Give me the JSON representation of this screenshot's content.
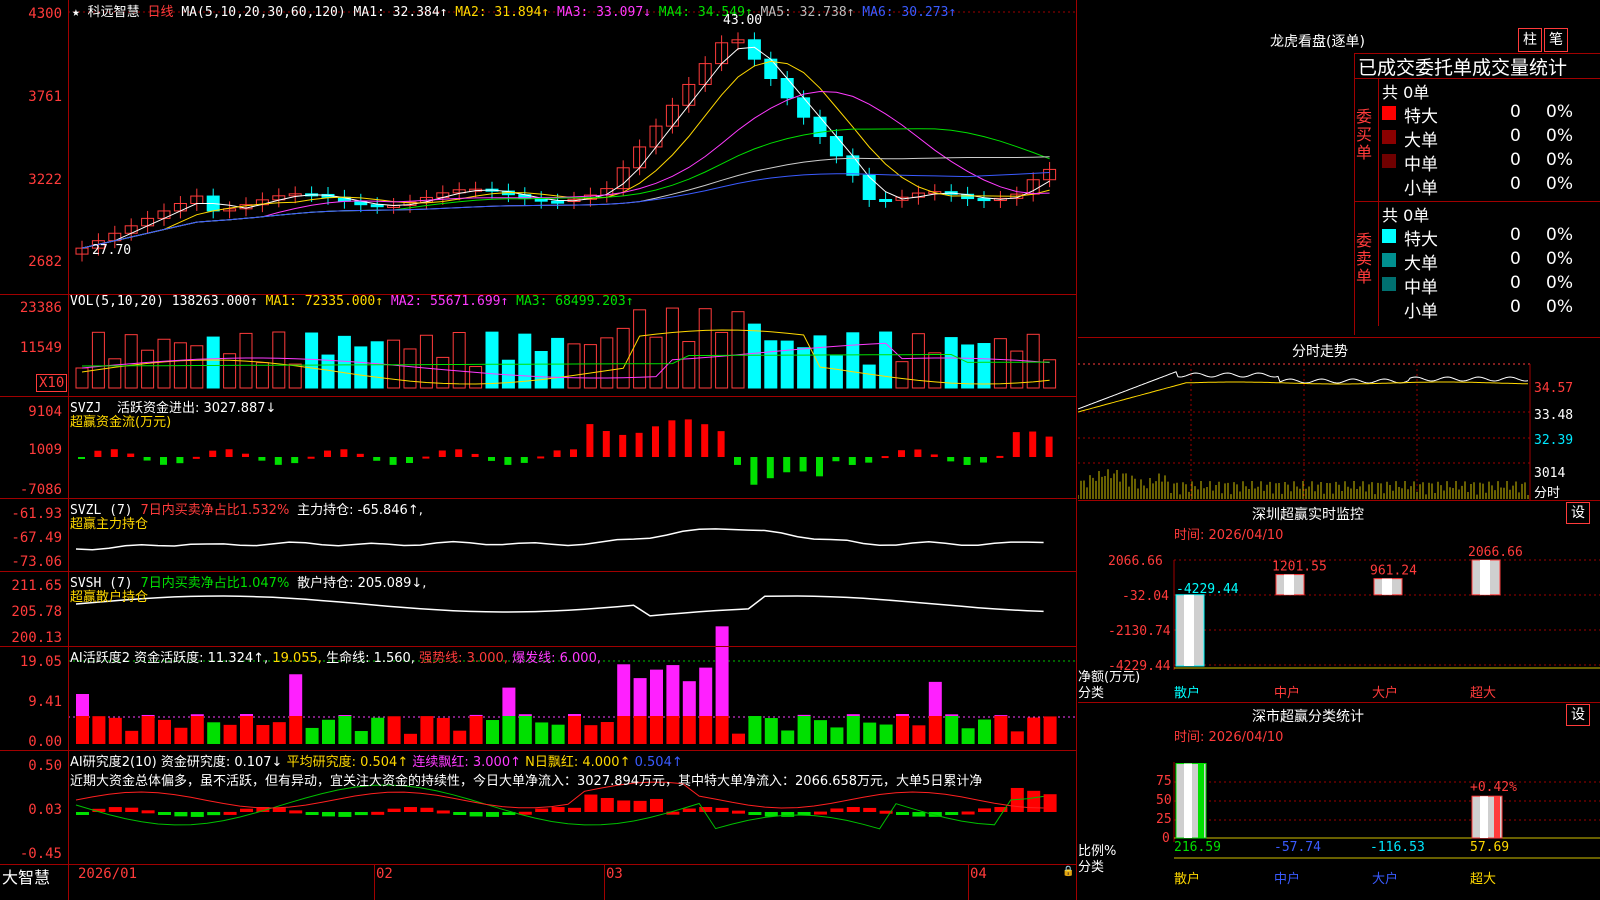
{
  "stock": {
    "star": "★",
    "name": "科远智慧",
    "period": "日线"
  },
  "ma_line": {
    "label": "MA(5,10,20,30,60,120)",
    "ma1": "MA1: 32.384↑",
    "ma2": "MA2: 31.894↑",
    "ma3": "MA3: 33.097↓",
    "ma4": "MA4: 34.549↑",
    "ma5": "MA5: 32.738↑",
    "ma6": "MA6: 30.273↑"
  },
  "price_axis": [
    "4300",
    "3761",
    "3222",
    "2682"
  ],
  "price_marks": {
    "high": "43.00",
    "low": "27.70"
  },
  "vol": {
    "label": "VOL(5,10,20)",
    "value": "138263.000↑",
    "ma1": "MA1: 72335.000↑",
    "ma2": "MA2: 55671.699↑",
    "ma3": "MA3: 68499.203↑",
    "axis": [
      "23386",
      "11549"
    ],
    "unit": "X10"
  },
  "svzj": {
    "label": "SVZJ",
    "desc": "活跃资金进出: 3027.887↓",
    "sub": "超赢资金流(万元)",
    "axis": [
      "9104",
      "1009",
      "-7086"
    ]
  },
  "svzl": {
    "label": "SVZL (7)",
    "pct": "7日内买卖净占比1.532%",
    "hold": "主力持仓: -65.846↑,",
    "sub": "超赢主力持仓",
    "axis": [
      "-61.93",
      "-67.49",
      "-73.06"
    ]
  },
  "svsh": {
    "label": "SVSH (7)",
    "pct": "7日内买卖净占比1.047%",
    "hold": "散户持仓: 205.089↓,",
    "sub": "超赢散户持仓",
    "axis": [
      "211.65",
      "205.78",
      "200.13"
    ]
  },
  "ai_active": {
    "label": "AI活跃度2",
    "act": "资金活跃度: 11.324↑,",
    "v2": "19.055,",
    "life": "生命线: 1.560,",
    "strong": "强势线: 3.000,",
    "burst": "爆发线: 6.000,",
    "axis": [
      "19.05",
      "9.41",
      "0.00"
    ]
  },
  "ai_research": {
    "label": "AI研究度2(10)",
    "res": "资金研究度: 0.107↓",
    "avg": "平均研究度: 0.504↑",
    "cont": "连续飘红: 3.000↑",
    "nday": "N日飘红: 4.000↑",
    "v5": "0.504↑",
    "text": "近期大资金总体偏多，虽不活跃，但有异动，宜关注大资金的持续性，今日大单净流入：3027.894万元，其中特大单净流入：2066.658万元，大单5日累计净",
    "axis": [
      "0.50",
      "0.03",
      "-0.45"
    ]
  },
  "dates": [
    "2026/01",
    "02",
    "03",
    "04"
  ],
  "brand": "大智慧",
  "panel_lhb": {
    "title": "龙虎看盘(逐单)",
    "btn1": "柱",
    "btn2": "笔",
    "header": "已成交委托单成交量统计",
    "buy_label": "委买单",
    "sell_label": "委卖单",
    "buy_total": "共 0单",
    "sell_total": "共 0单",
    "buy": [
      {
        "name": "特大",
        "val": "0",
        "pct": "0%",
        "color": "#ff0000"
      },
      {
        "name": "大单",
        "val": "0",
        "pct": "0%",
        "color": "#8b0000"
      },
      {
        "name": "中单",
        "val": "0",
        "pct": "0%",
        "color": "#700000"
      },
      {
        "name": "小单",
        "val": "0",
        "pct": "0%",
        "color": "#000000"
      }
    ],
    "sell": [
      {
        "name": "特大",
        "val": "0",
        "pct": "0%",
        "color": "#00ffff"
      },
      {
        "name": "大单",
        "val": "0",
        "pct": "0%",
        "color": "#009090"
      },
      {
        "name": "中单",
        "val": "0",
        "pct": "0%",
        "color": "#007070"
      },
      {
        "name": "小单",
        "val": "0",
        "pct": "0%",
        "color": "#000000"
      }
    ]
  },
  "panel_fs": {
    "title": "分时走势",
    "axis": [
      "34.57",
      "33.48",
      "32.39"
    ],
    "vol": "3014",
    "unit": "分时"
  },
  "panel_monitor": {
    "title": "深圳超赢实时监控",
    "btn": "设",
    "time": "时间: 2026/04/10",
    "axis": [
      "2066.66",
      "-32.04",
      "-2130.74",
      "-4229.44"
    ],
    "ylabel": "净额(万元)",
    "xlabel": "分类",
    "cats": [
      "散户",
      "中户",
      "大户",
      "超大"
    ],
    "values": [
      "-4229.44",
      "1201.55",
      "961.24",
      "2066.66"
    ]
  },
  "panel_class": {
    "title": "深市超赢分类统计",
    "btn": "设",
    "time": "时间: 2026/04/10",
    "axis": [
      "75",
      "50",
      "25",
      "0"
    ],
    "ylabel": "比例%",
    "xlabel": "分类",
    "cats": [
      "散户",
      "中户",
      "大户",
      "超大"
    ],
    "values": [
      "216.59",
      "-57.74",
      "-116.53",
      "57.69"
    ],
    "note": "+0.42%"
  },
  "chart_data": {
    "type": "bar",
    "title": "深圳超赢实时监控",
    "ylabel": "净额(万元)",
    "xlabel": "分类",
    "categories": [
      "散户",
      "中户",
      "大户",
      "超大"
    ],
    "values": [
      -4229.44,
      1201.55,
      961.24,
      2066.66
    ],
    "ylim": [
      -4229.44,
      2066.66
    ]
  }
}
